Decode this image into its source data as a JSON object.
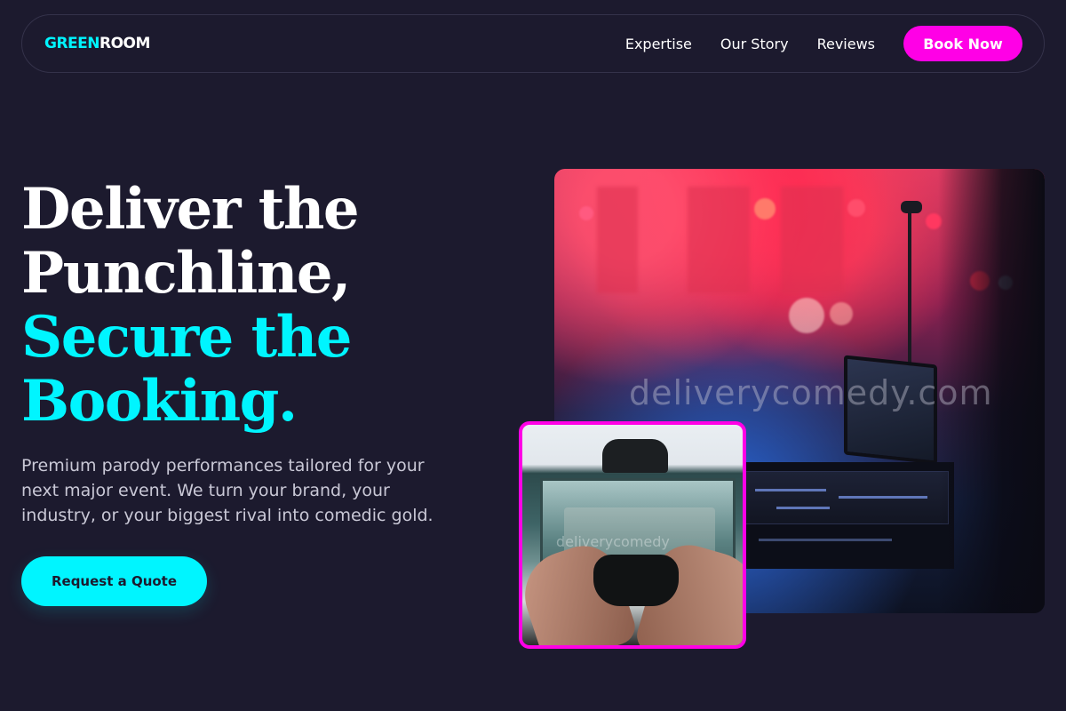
{
  "nav": {
    "logo_green": "GREEN",
    "logo_white": "ROOM",
    "links": [
      "Expertise",
      "Our Story",
      "Reviews"
    ],
    "cta": "Book Now"
  },
  "hero": {
    "title_line1": "Deliver the",
    "title_line2": "Punchline,",
    "title_line3": "Secure the",
    "title_line4": "Booking.",
    "subtitle": "Premium parody performances tailored for your next major event. We turn your brand, your industry, or your biggest rival into comedic gold.",
    "cta": "Request a Quote"
  },
  "images": {
    "watermark": "deliverycomedy.com",
    "small_watermark": "deliverycomedy"
  },
  "colors": {
    "background": "#1c1a2e",
    "accent_cyan": "#00f5ff",
    "accent_magenta": "#ff00e6"
  }
}
